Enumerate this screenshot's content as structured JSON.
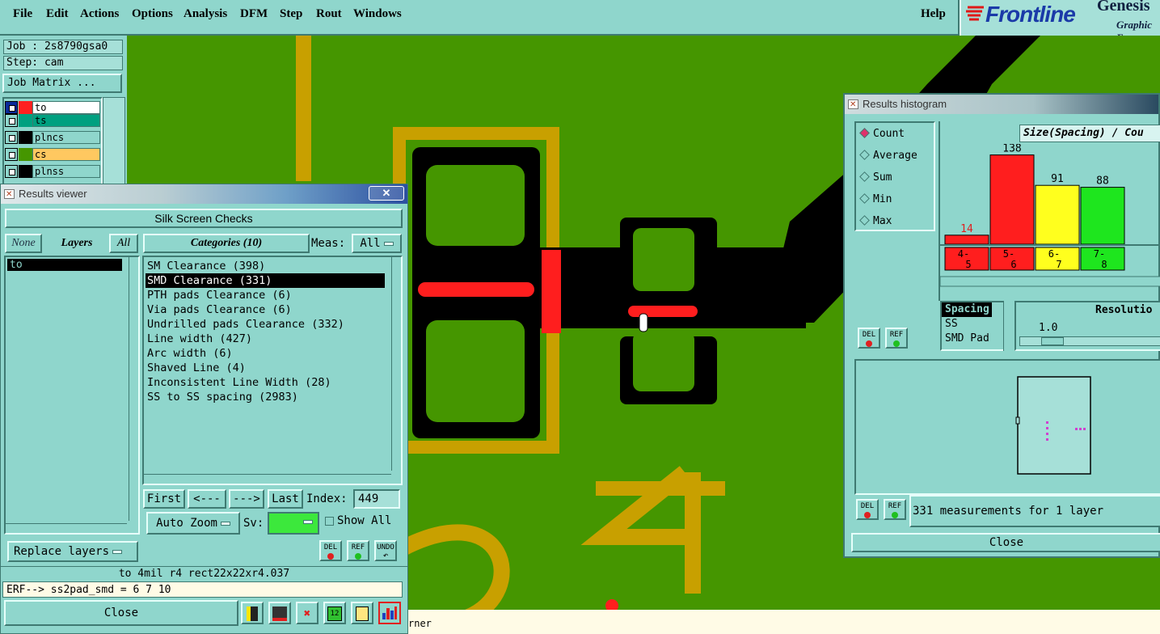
{
  "menubar": {
    "items": [
      "File",
      "Edit",
      "Actions",
      "Options",
      "Analysis",
      "DFM",
      "Step",
      "Rout",
      "Windows"
    ],
    "help": "Help"
  },
  "brand": {
    "logo": "Frontline",
    "product": "Genesis",
    "sub": "Graphic E"
  },
  "job": {
    "job_label": "Job : 2s8790gsa0",
    "step_label": "Step: cam",
    "matrix_button": "Job Matrix ..."
  },
  "layers": [
    {
      "name": "to",
      "color": "#ff2020",
      "bg": "#ffffff"
    },
    {
      "name": "ts",
      "color": "#00a080",
      "bg": "#00a080"
    },
    {
      "name": "plncs",
      "color": "#000000",
      "bg": "#8fd6cc"
    },
    {
      "name": "cs",
      "color": "#459600",
      "bg": "#ffc860"
    },
    {
      "name": "plnss",
      "color": "#000000",
      "bg": "#8fd6cc"
    }
  ],
  "results_viewer": {
    "title": "Results viewer",
    "header": "Silk Screen Checks",
    "none_btn": "None",
    "layers_btn": "Layers",
    "all_btn": "All",
    "layer_list": [
      "to"
    ],
    "categories_label": "Categories (10)",
    "meas_label": "Meas:",
    "meas_value": "All",
    "categories": [
      "SM Clearance (398)",
      "SMD Clearance (331)",
      "PTH pads Clearance (6)",
      "Via pads Clearance (6)",
      "Undrilled pads Clearance (332)",
      "Line width (427)",
      "Arc width (6)",
      "Shaved Line (4)",
      "Inconsistent Line Width (28)",
      "SS to SS spacing (2983)"
    ],
    "selected_category": 1,
    "first_btn": "First",
    "prev_btn": "<---",
    "next_btn": "--->",
    "last_btn": "Last",
    "index_label": "Index:",
    "index_value": "449",
    "auto_zoom": "Auto Zoom",
    "sv_label": "Sv:",
    "show_all": "Show All",
    "replace_layers": "Replace layers",
    "del": "DEL",
    "ref": "REF",
    "undo": "UNDO",
    "info_line": "to   4mil  r4  rect22x22xr4.037",
    "erf_line": "ERF--> ss2pad_smd = 6 7 10",
    "close": "Close"
  },
  "histogram": {
    "title": "Results histogram",
    "modes": [
      "Count",
      "Average",
      "Sum",
      "Min",
      "Max"
    ],
    "selected_mode": 0,
    "chart_title": "Size(Spacing) / Cou",
    "types": [
      "Spacing",
      "SS",
      "SMD Pad"
    ],
    "resolution_label": "Resolutio",
    "resolution_value": "1.0",
    "measurements": "331 measurements for 1 layer",
    "close": "Close",
    "del": "DEL",
    "ref": "REF"
  },
  "chart_data": {
    "type": "bar",
    "categories": [
      "4-5",
      "5-6",
      "6-7",
      "7-8"
    ],
    "values": [
      14,
      138,
      91,
      88
    ],
    "colors": [
      "#ff1e1e",
      "#ff1e1e",
      "#ffff1e",
      "#1ee61e"
    ],
    "title": "Size(Spacing) / Cou",
    "xlabel": "",
    "ylabel": "",
    "ylim": [
      0,
      150
    ]
  },
  "status": {
    "text": "rner"
  },
  "canvas_labels": {
    "digit_a": "4"
  }
}
